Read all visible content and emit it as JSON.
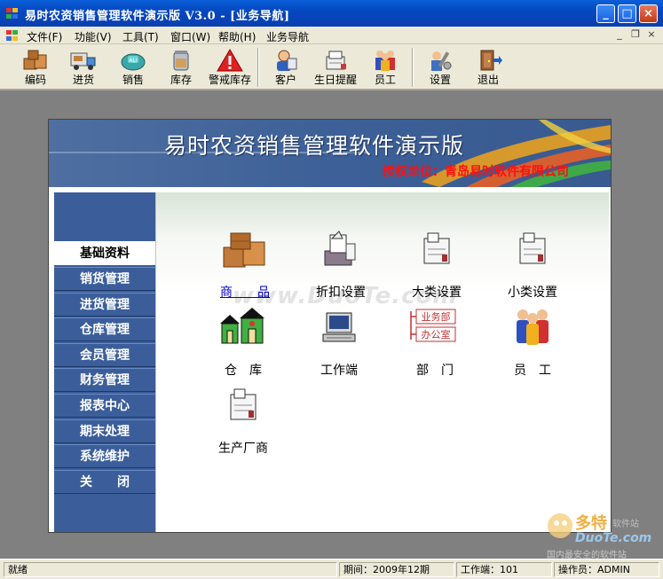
{
  "window": {
    "title": "易时农资销售管理软件演示版 V3.0 - [业务导航]",
    "minimize_symbol": "_",
    "maximize_symbol": "□",
    "close_symbol": "×"
  },
  "menubar": {
    "items": [
      "文件(F)",
      "功能(V)",
      "工具(T)",
      "窗口(W)",
      "帮助(H)",
      "业务导航"
    ],
    "mdi_controls": [
      "_",
      "❐",
      "×"
    ]
  },
  "toolbar": {
    "items": [
      {
        "label": "编码",
        "icon": "boxes-icon"
      },
      {
        "label": "进货",
        "icon": "delivery-truck-icon"
      },
      {
        "label": "销售",
        "icon": "sales-cart-icon"
      },
      {
        "label": "库存",
        "icon": "inventory-jar-icon"
      },
      {
        "label": "警戒库存",
        "icon": "warning-icon"
      },
      {
        "label": "客户",
        "icon": "customer-icon"
      },
      {
        "label": "生日提醒",
        "icon": "birthday-icon"
      },
      {
        "label": "员工",
        "icon": "employees-icon"
      },
      {
        "label": "设置",
        "icon": "settings-tools-icon"
      },
      {
        "label": "退出",
        "icon": "exit-door-icon"
      }
    ]
  },
  "banner": {
    "title": "易时农资销售管理软件演示版",
    "subtitle": "授权单位：青岛易时软件有限公司"
  },
  "sidebar": {
    "items": [
      "基础资料",
      "销货管理",
      "进货管理",
      "仓库管理",
      "会员管理",
      "财务管理",
      "报表中心",
      "期末处理",
      "系统维护",
      "关　　闭"
    ],
    "active_index": 0
  },
  "content": {
    "watermark": "www.DuoTe.com",
    "tiles": [
      {
        "label": "商　　品",
        "icon": "product-boxes-icon"
      },
      {
        "label": "折扣设置",
        "icon": "discount-printer-icon"
      },
      {
        "label": "大类设置",
        "icon": "category-printer-icon"
      },
      {
        "label": "小类设置",
        "icon": "subcategory-printer-icon"
      },
      {
        "label": "仓　库",
        "icon": "warehouse-icon"
      },
      {
        "label": "工作端",
        "icon": "terminal-icon"
      },
      {
        "label": "部　门",
        "icon": "department-icon"
      },
      {
        "label": "员　工",
        "icon": "staff-icon"
      },
      {
        "label": "生产厂商",
        "icon": "manufacturer-printer-icon"
      }
    ],
    "dept_tags": [
      "业务部",
      "办公室"
    ]
  },
  "statusbar": {
    "status": "就绪",
    "period": "期间：2009年12期",
    "terminal": "工作端：101",
    "operator": "操作员：ADMIN"
  },
  "corner_logo": {
    "line1": "多特",
    "line1b": "软件站",
    "line2": "DuoTe.com",
    "line3": "国内最安全的软件站"
  }
}
